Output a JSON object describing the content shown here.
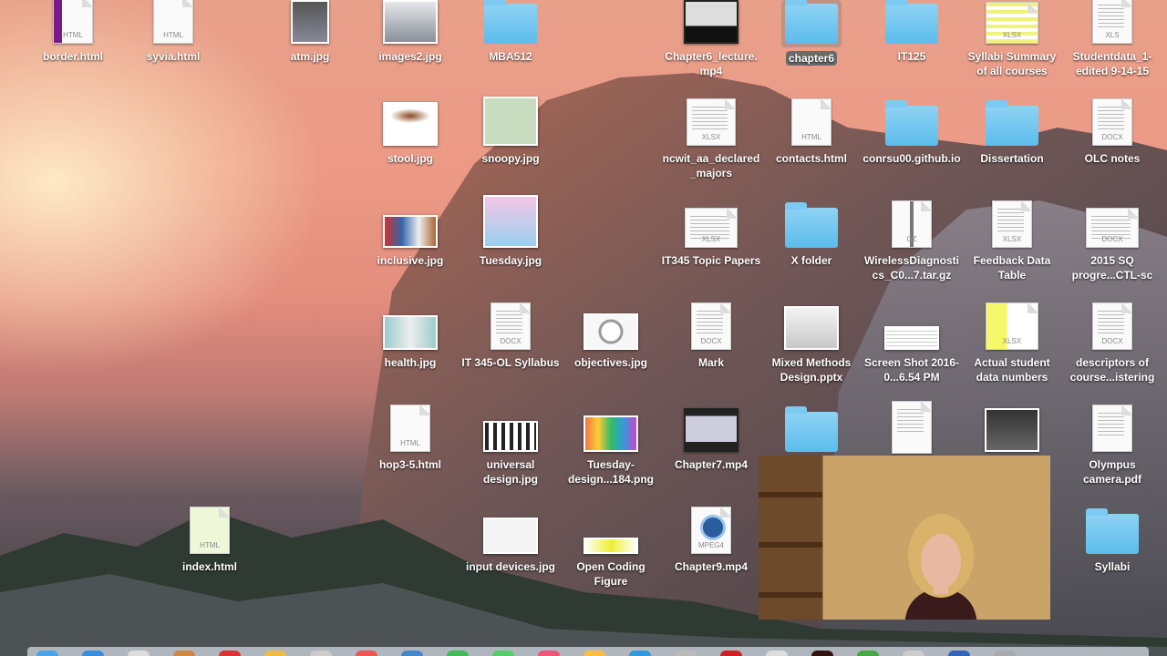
{
  "desktop": {
    "icons": [
      {
        "label": "border.html",
        "kind": "doc",
        "ext": "HTML"
      },
      {
        "label": "syvia.html",
        "kind": "doc",
        "ext": "HTML"
      },
      {
        "label": "atm.jpg",
        "kind": "photo"
      },
      {
        "label": "images2.jpg",
        "kind": "photo"
      },
      {
        "label": "MBA512",
        "kind": "folder"
      },
      {
        "label": "Chapter6_lecture.mp4",
        "kind": "video"
      },
      {
        "label": "chapter6",
        "kind": "folder"
      },
      {
        "label": "IT125",
        "kind": "folder"
      },
      {
        "label": "Syllabi Summary of all courses",
        "kind": "doc",
        "ext": "XLSX"
      },
      {
        "label": "Studentdata_1-edited 9-14-15",
        "kind": "doc",
        "ext": "XLS"
      },
      {
        "label": "stool.jpg",
        "kind": "photo"
      },
      {
        "label": "snoopy.jpg",
        "kind": "photo"
      },
      {
        "label": "ncwit_aa_declared_majors",
        "kind": "doc",
        "ext": "XLSX"
      },
      {
        "label": "contacts.html",
        "kind": "doc",
        "ext": "HTML"
      },
      {
        "label": "conrsu00.github.io",
        "kind": "folder"
      },
      {
        "label": "Dissertation",
        "kind": "folder"
      },
      {
        "label": "OLC notes",
        "kind": "doc",
        "ext": "DOCX"
      },
      {
        "label": "inclusive.jpg",
        "kind": "photo"
      },
      {
        "label": "Tuesday.jpg",
        "kind": "photo"
      },
      {
        "label": "IT345 Topic Papers",
        "kind": "doc",
        "ext": "XLSX"
      },
      {
        "label": "X folder",
        "kind": "folder"
      },
      {
        "label": "WirelessDiagnostics_C0...7.tar.gz",
        "kind": "doc",
        "ext": "GZ"
      },
      {
        "label": "Feedback Data Table",
        "kind": "doc",
        "ext": "XLSX"
      },
      {
        "label": "2015 SQ progre...CTL-sc",
        "kind": "doc",
        "ext": "DOCX"
      },
      {
        "label": "health.jpg",
        "kind": "photo"
      },
      {
        "label": "IT 345-OL Syllabus",
        "kind": "doc",
        "ext": "DOCX"
      },
      {
        "label": "objectives.jpg",
        "kind": "photo"
      },
      {
        "label": "Mark",
        "kind": "doc",
        "ext": "DOCX"
      },
      {
        "label": "Mixed Methods Design.pptx",
        "kind": "slide"
      },
      {
        "label": "Screen Shot 2016-0...6.54 PM",
        "kind": "photo"
      },
      {
        "label": "Actual student data numbers",
        "kind": "doc",
        "ext": "XLSX"
      },
      {
        "label": "descriptors of course...istering",
        "kind": "doc",
        "ext": "DOCX"
      },
      {
        "label": "hop3-5.html",
        "kind": "doc",
        "ext": "HTML"
      },
      {
        "label": "universal design.jpg",
        "kind": "photo"
      },
      {
        "label": "Tuesday-design...184.png",
        "kind": "photo"
      },
      {
        "label": "Chapter7.mp4",
        "kind": "video"
      },
      {
        "label": "Olympus camera.pdf",
        "kind": "doc",
        "ext": ""
      },
      {
        "label": "index.html",
        "kind": "doc",
        "ext": "HTML"
      },
      {
        "label": "input devices.jpg",
        "kind": "photo"
      },
      {
        "label": "Open Coding Figure",
        "kind": "photo"
      },
      {
        "label": "Chapter9.mp4",
        "kind": "doc",
        "ext": "MPEG4"
      },
      {
        "label": "Syllabi",
        "kind": "folder"
      }
    ]
  },
  "selected_icon": "chapter6",
  "colors": {
    "folder": "#5bbcec",
    "label_shadow": "#000000",
    "selection": "#6b6b6b"
  }
}
